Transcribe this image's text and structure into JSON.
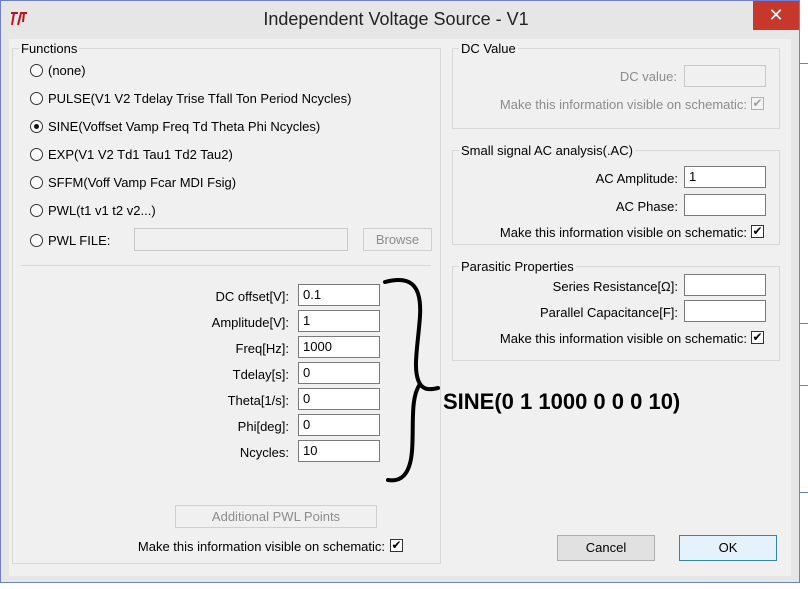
{
  "window": {
    "title": "Independent Voltage Source - V1",
    "close_glyph": "✕"
  },
  "functions": {
    "legend": "Functions",
    "options": [
      {
        "label": "(none)",
        "selected": false
      },
      {
        "label": "PULSE(V1 V2 Tdelay Trise Tfall Ton Period Ncycles)",
        "selected": false
      },
      {
        "label": "SINE(Voffset Vamp Freq Td Theta Phi Ncycles)",
        "selected": true
      },
      {
        "label": "EXP(V1 V2 Td1 Tau1 Td2 Tau2)",
        "selected": false
      },
      {
        "label": "SFFM(Voff Vamp Fcar MDI Fsig)",
        "selected": false
      },
      {
        "label": "PWL(t1 v1 t2 v2...)",
        "selected": false
      },
      {
        "label": "PWL FILE:",
        "selected": false
      }
    ],
    "pwl_file_value": "",
    "browse_label": "Browse",
    "params": [
      {
        "label": "DC offset[V]:",
        "value": "0.1"
      },
      {
        "label": "Amplitude[V]:",
        "value": "1"
      },
      {
        "label": "Freq[Hz]:",
        "value": "1000"
      },
      {
        "label": "Tdelay[s]:",
        "value": "0"
      },
      {
        "label": "Theta[1/s]:",
        "value": "0"
      },
      {
        "label": "Phi[deg]:",
        "value": "0"
      },
      {
        "label": "Ncycles:",
        "value": "10"
      }
    ],
    "additional_pwl_label": "Additional PWL Points",
    "visible_label": "Make this information visible on schematic:",
    "visible_checked": true
  },
  "dc_value": {
    "legend": "DC Value",
    "dc_label": "DC value:",
    "dc_value": "",
    "visible_label": "Make this information visible on schematic:",
    "visible_checked": true
  },
  "ac": {
    "legend": "Small signal AC analysis(.AC)",
    "amplitude_label": "AC Amplitude:",
    "amplitude_value": "1",
    "phase_label": "AC Phase:",
    "phase_value": "",
    "visible_label": "Make this information visible on schematic:",
    "visible_checked": true
  },
  "parasitic": {
    "legend": "Parasitic Properties",
    "series_label": "Series Resistance[Ω]:",
    "series_value": "",
    "parallel_label": "Parallel Capacitance[F]:",
    "parallel_value": "",
    "visible_label": "Make this information visible on schematic:",
    "visible_checked": true
  },
  "buttons": {
    "cancel": "Cancel",
    "ok": "OK"
  },
  "annotation": "SINE(0 1 1000 0 0 0 10)",
  "check_glyph": "✔",
  "colors": {
    "close_button": "#c7372b",
    "window_border": "#6e7ed6",
    "ok_border": "#3c7fb1",
    "icon_red": "#c0141c"
  }
}
